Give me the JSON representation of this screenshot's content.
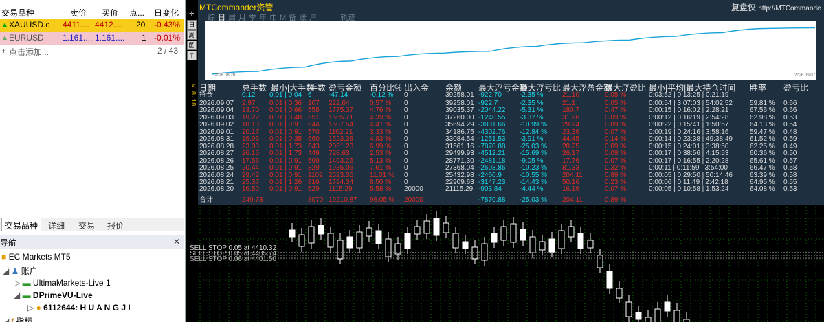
{
  "market_watch": {
    "columns": [
      "交易品种",
      "卖价",
      "买价",
      "点...",
      "日变化"
    ],
    "rows": [
      {
        "symbol": "XAUUSD.c",
        "bid": "4411....",
        "ask": "4412....",
        "spread": "20",
        "change": "-0.43%"
      },
      {
        "symbol": "EURUSD",
        "bid": "1.161....",
        "ask": "1.161....",
        "spread": "1",
        "change": "-0.01%"
      }
    ],
    "add_label": "点击添加...",
    "count": "2 / 43",
    "tabs": [
      "交易品种",
      "详细",
      "交易",
      "报价"
    ]
  },
  "navigator": {
    "title": "导航",
    "broker": "EC Markets MT5",
    "accounts_label": "账户",
    "servers": [
      "UltimaMarkets-Live 1",
      "DPrimeVU-Live"
    ],
    "account": "6112644: H U A N G J I",
    "indicators_label": "指标"
  },
  "chart_side": {
    "tools": [
      "✛",
      "日",
      "周",
      "图",
      "T"
    ],
    "vertical_text": "V 8.18"
  },
  "panel": {
    "title": "MTCommander资管",
    "right_text": "复盘侠",
    "right_url": "http://MTCommande",
    "period_tabs": [
      "综",
      "日",
      "周",
      "月",
      "季",
      "年",
      "巾",
      "M",
      "备",
      "账",
      "户",
      "轨迹"
    ],
    "selected_tab": "日",
    "curve_dates": [
      "2026.08.20",
      "2026.09.07"
    ],
    "headers": [
      "日期",
      "总手数",
      "最小|大手数",
      "手数",
      "盈亏金额",
      "百分比%",
      "出入金",
      "余额",
      "最大浮亏金额",
      "最大浮亏比",
      "最大浮盈金额",
      "最大浮盈比",
      "最小|平均|最大持仓时间",
      "胜率",
      "盈亏比"
    ],
    "holdings": {
      "date": "持仓",
      "lots": "0.12",
      "minmax": "0.01 | 0.04",
      "count": "6",
      "pnl": "-47.14",
      "pct": "-0.12 %",
      "io": "0",
      "bal": "39258.01",
      "fl": "-922.70",
      "flp": "-2.35 %",
      "fw": "21.10",
      "fwp": "0.05 %",
      "hold": "0:03:52 | 0:13:25 | 0:21:19"
    },
    "rows": [
      {
        "date": "2026.09.07",
        "lots": "2.97",
        "minmax": "0.01 | 0.36",
        "count": "107",
        "pnl": "222.64",
        "pct": "0.57 %",
        "io": "0",
        "bal": "39258.01",
        "fl": "-922.7",
        "flp": "-2.35 %",
        "fw": "21.1",
        "fwp": "0.05 %",
        "hold": "0:00:54 | 3:07:03 | 54:02:52",
        "win": "59.81 %",
        "rr": "0.66"
      },
      {
        "date": "2026.09.04",
        "lots": "13.70",
        "minmax": "0.01 | 0.66",
        "count": "558",
        "pnl": "1775.37",
        "pct": "4.76 %",
        "io": "0",
        "bal": "39035.37",
        "fl": "-2044.22",
        "flp": "-5.31 %",
        "fw": "180.7",
        "fwp": "0.47 %",
        "hold": "0:00:15 | 0:16:02 | 2:28:21",
        "win": "67.56 %",
        "rr": "0.66"
      },
      {
        "date": "2026.09.03",
        "lots": "19.22",
        "minmax": "0.01 | 0.48",
        "count": "651",
        "pnl": "1565.71",
        "pct": "4.39 %",
        "io": "0",
        "bal": "37260.00",
        "fl": "-1240.55",
        "flp": "-3.37 %",
        "fw": "31.96",
        "fwp": "0.09 %",
        "hold": "0:00:12 | 0:16:19 | 2:54:28",
        "win": "62.98 %",
        "rr": "0.53"
      },
      {
        "date": "2026.09.02",
        "lots": "18.10",
        "minmax": "0.01 | 0.91",
        "count": "644",
        "pnl": "1507.54",
        "pct": "4.41 %",
        "io": "0",
        "bal": "35694.29",
        "fl": "-3881.66",
        "flp": "-10.99 %",
        "fw": "29.94",
        "fwp": "0.09 %",
        "hold": "0:00:22 | 0:15:41 | 1:50:57",
        "win": "64.13 %",
        "rr": "0.54"
      },
      {
        "date": "2026.09.01",
        "lots": "20.17",
        "minmax": "0.01 | 0.91",
        "count": "570",
        "pnl": "1102.21",
        "pct": "3.33 %",
        "io": "0",
        "bal": "34186.75",
        "fl": "-4302.76",
        "flp": "-12.84 %",
        "fw": "23.36",
        "fwp": "0.07 %",
        "hold": "0:00:19 | 0:24:16 | 3:58:16",
        "win": "59.47 %",
        "rr": "0.48"
      },
      {
        "date": "2026.08.31",
        "lots": "16.93",
        "minmax": "0.01 | 0.35",
        "count": "660",
        "pnl": "1523.38",
        "pct": "4.83 %",
        "io": "0",
        "bal": "33084.54",
        "fl": "-1251.53",
        "flp": "-3.91 %",
        "fw": "44.45",
        "fwp": "0.14 %",
        "hold": "0:00:14 | 0:23:38 | 49:38:49",
        "win": "61.52 %",
        "rr": "0.59"
      },
      {
        "date": "2026.08.28",
        "lots": "23.08",
        "minmax": "0.01 | 1.73",
        "count": "543",
        "pnl": "2061.23",
        "pct": "6.99 %",
        "io": "0",
        "bal": "31561.16",
        "fl": "-7870.88",
        "flp": "-25.03 %",
        "fw": "28.25",
        "fwp": "0.09 %",
        "hold": "0:00:15 | 0:24:01 | 3:38:50",
        "win": "62.25 %",
        "rr": "0.49"
      },
      {
        "date": "2026.08.27",
        "lots": "26.15",
        "minmax": "0.01 | 1.73",
        "count": "449",
        "pnl": "728.63",
        "pct": "2.53 %",
        "io": "0",
        "bal": "29499.93",
        "fl": "-4512.21",
        "flp": "-15.69 %",
        "fw": "26.17",
        "fwp": "0.09 %",
        "hold": "0:00:17 | 0:38:56 | 4:15:53",
        "win": "60.36 %",
        "rr": "0.50"
      },
      {
        "date": "2026.08.26",
        "lots": "17.56",
        "minmax": "0.01 | 0.91",
        "count": "599",
        "pnl": "1403.26",
        "pct": "5.13 %",
        "io": "0",
        "bal": "28771.30",
        "fl": "-2481.18",
        "flp": "-9.05 %",
        "fw": "17.76",
        "fwp": "0.07 %",
        "hold": "0:00:17 | 0:16:55 | 2:20:28",
        "win": "65.61 %",
        "rr": "0.57"
      },
      {
        "date": "2026.08.25",
        "lots": "20.44",
        "minmax": "0.01 | 0.91",
        "count": "829",
        "pnl": "1935.06",
        "pct": "7.61 %",
        "io": "0",
        "bal": "27368.04",
        "fl": "-2603.86",
        "flp": "-10.23 %",
        "fw": "81.33",
        "fwp": "0.32 %",
        "hold": "0:00:11 | 0:11:59 | 3:54:00",
        "win": "66.47 %",
        "rr": "0.58"
      },
      {
        "date": "2026.08.24",
        "lots": "29.42",
        "minmax": "0.01 | 0.91",
        "count": "1109",
        "pnl": "2523.35",
        "pct": "11.01 %",
        "io": "0",
        "bal": "25432.98",
        "fl": "-2460.9",
        "flp": "-10.55 %",
        "fw": "204.11",
        "fwp": "0.89 %",
        "hold": "0:00:05 | 0:29:50 | 50:14:46",
        "win": "63.39 %",
        "rr": "0.58"
      },
      {
        "date": "2026.08.21",
        "lots": "25.37",
        "minmax": "0.01 | 1.26",
        "count": "816",
        "pnl": "1794.34",
        "pct": "8.50 %",
        "io": "0",
        "bal": "22909.63",
        "fl": "-3147.23",
        "flp": "-14.43 %",
        "fw": "50.16",
        "fwp": "0.23 %",
        "hold": "0:00:06 | 0:11:49 | 2:42:18",
        "win": "64.95 %",
        "rr": "0.55"
      },
      {
        "date": "2026.08.20",
        "lots": "16.50",
        "minmax": "0.01 | 0.91",
        "count": "529",
        "pnl": "1115.29",
        "pct": "5.58 %",
        "io": "20000",
        "bal": "21115.29",
        "fl": "-903.84",
        "flp": "-4.44 %",
        "fw": "16.16",
        "fwp": "0.07 %",
        "hold": "0:00:05 | 0:10:58 | 1:53:24",
        "win": "64.08 %",
        "rr": "0.53"
      }
    ],
    "total": {
      "date": "合计",
      "lots": "249.73",
      "count": "8070",
      "pnl": "19210.87",
      "pct": "96.05 %",
      "io": "20000",
      "fl": "-7870.88",
      "flp": "-25.03 %",
      "fw": "204.11",
      "fwp": "0.89 %"
    }
  },
  "sell_line": "SELL STOP 0.05 at 4410.32",
  "colors": {
    "cyan": "#19d5e6",
    "red": "#e12b22",
    "panel_bg": "#1e3040",
    "grid_green": "#0ec400",
    "candle": "#ffffff"
  }
}
